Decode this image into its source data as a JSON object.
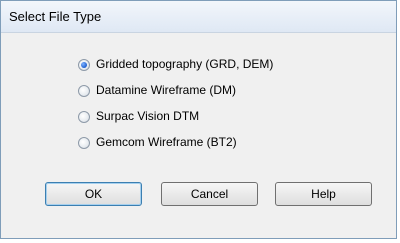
{
  "window": {
    "title": "Select File Type"
  },
  "file_types": {
    "options": [
      {
        "label": "Gridded topography (GRD, DEM)",
        "selected": true
      },
      {
        "label": "Datamine Wireframe (DM)",
        "selected": false
      },
      {
        "label": "Surpac Vision DTM",
        "selected": false
      },
      {
        "label": "Gemcom Wireframe (BT2)",
        "selected": false
      }
    ]
  },
  "buttons": {
    "ok_label": "OK",
    "cancel_label": "Cancel",
    "help_label": "Help"
  }
}
